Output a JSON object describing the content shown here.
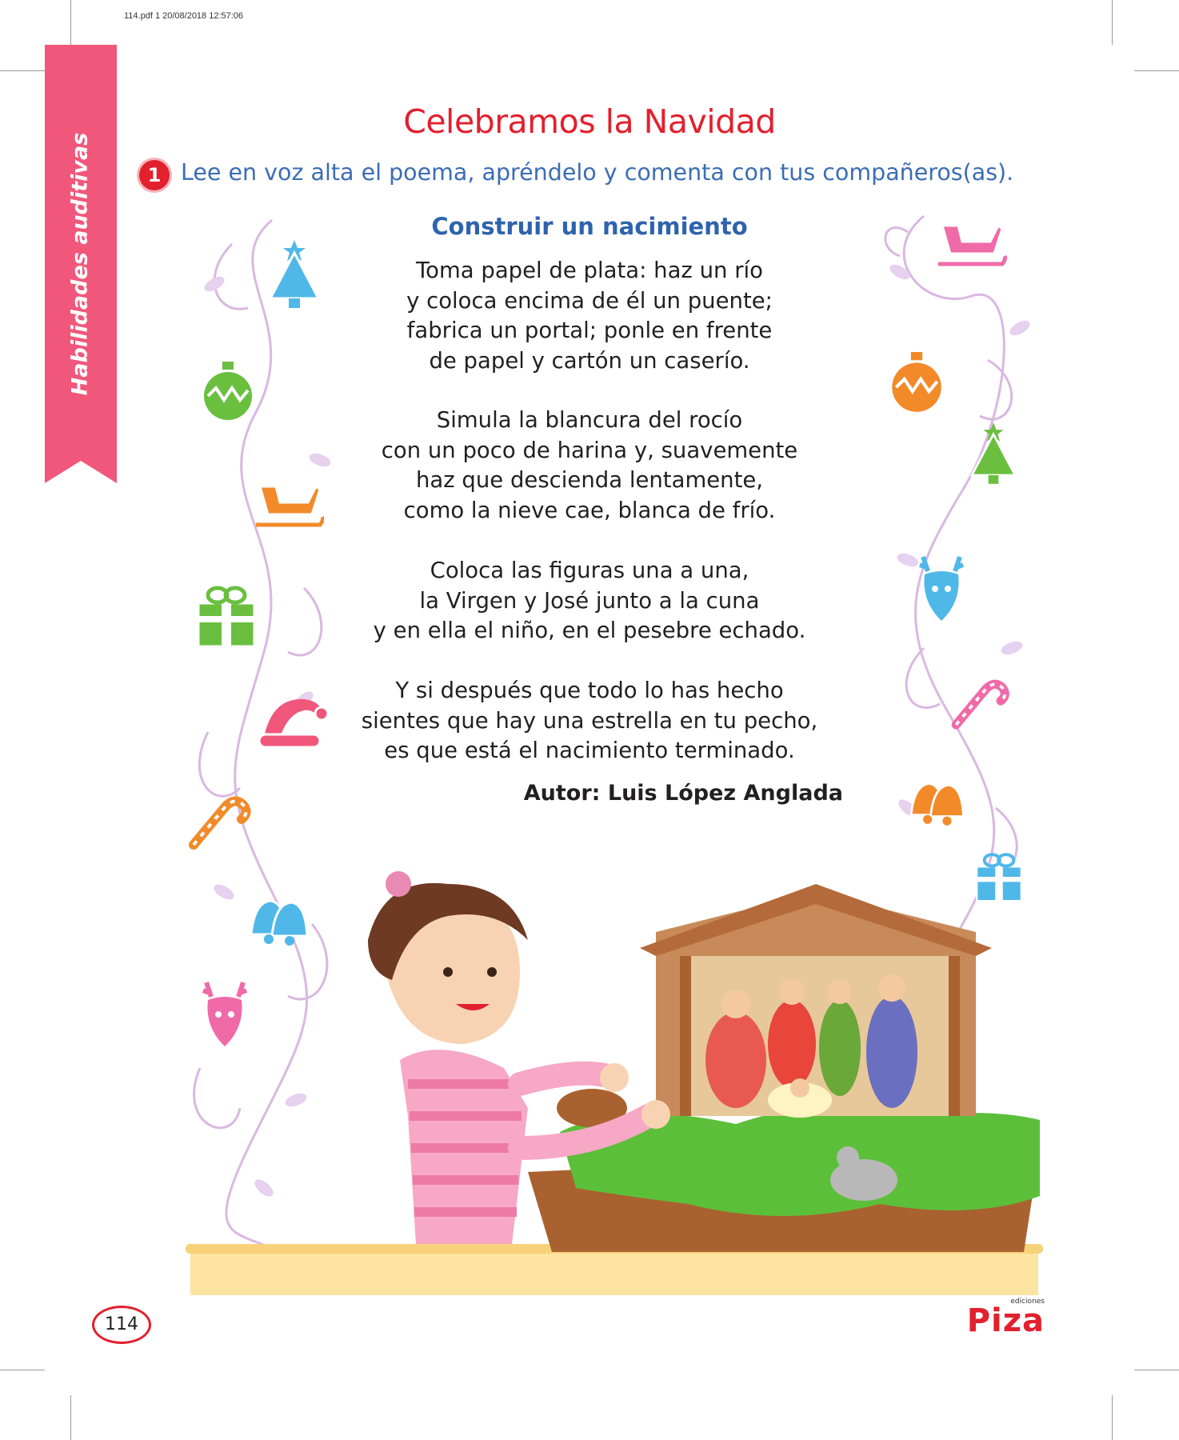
{
  "print_header": "114.pdf   1   20/08/2018   12:57:06",
  "side_tab": {
    "label": "Habilidades auditivas",
    "color": "#f0577b"
  },
  "title": "Celebramos la Navidad",
  "activity": {
    "number": "1",
    "instruction": "Lee en voz alta el poema, apréndelo y comenta con tus compañeros(as)."
  },
  "poem": {
    "title": "Construir un nacimiento",
    "stanzas": [
      [
        "Toma papel de plata: haz un río",
        "y coloca encima de él un puente;",
        "fabrica un portal; ponle en frente",
        "de papel y cartón un caserío."
      ],
      [
        "Simula la blancura del rocío",
        "con un poco de harina y, suavemente",
        "haz que descienda lentamente,",
        "como la nieve cae, blanca de frío."
      ],
      [
        "Coloca las figuras una a una,",
        "la Virgen y José junto a la cuna",
        "y en ella el niño, en el pesebre echado."
      ],
      [
        "Y si después que todo lo has hecho",
        "sientes que hay una estrella en tu pecho,",
        "es que está el nacimiento terminado."
      ]
    ],
    "author": "Autor: Luis López Anglada"
  },
  "page_number": "114",
  "publisher": {
    "small": "ediciones",
    "name": "Piza"
  },
  "colors": {
    "accent_red": "#e2202e",
    "instruction_blue": "#3b6db4",
    "tab_pink": "#f0577b"
  },
  "illustration": {
    "description_icons": [
      "tree-icon",
      "ornament-icon",
      "sleigh-icon",
      "gift-icon",
      "santa-hat-icon",
      "candy-cane-icon",
      "bells-icon",
      "reindeer-icon"
    ]
  }
}
